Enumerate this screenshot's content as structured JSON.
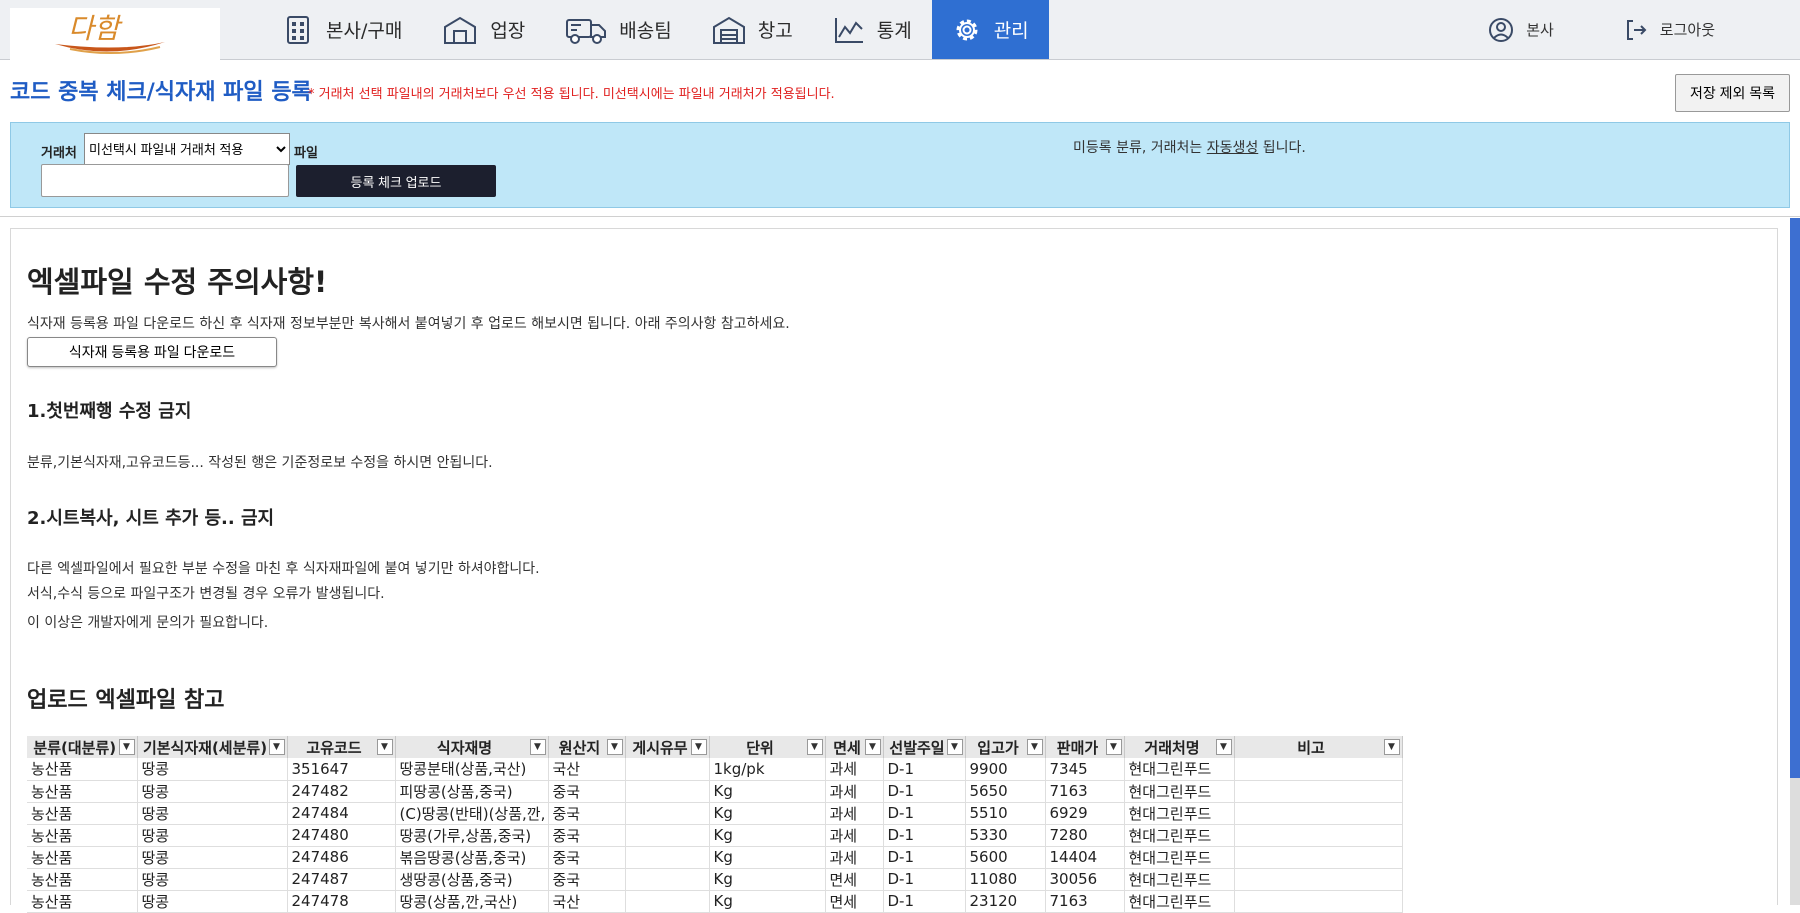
{
  "logo": {
    "text": "다함"
  },
  "nav": {
    "items": [
      {
        "label": "본사/구매",
        "icon": "building-icon"
      },
      {
        "label": "업장",
        "icon": "store-icon"
      },
      {
        "label": "배송팀",
        "icon": "truck-icon"
      },
      {
        "label": "창고",
        "icon": "warehouse-icon"
      },
      {
        "label": "통계",
        "icon": "chart-icon"
      },
      {
        "label": "관리",
        "icon": "gear-icon",
        "active": true
      }
    ],
    "user_label": "본사",
    "logout_label": "로그아웃"
  },
  "colors": {
    "accent": "#2f6fd2",
    "panel": "#bfe7f8",
    "note_red": "#e0201f",
    "title_blue": "#1f5cc4"
  },
  "header": {
    "title": "코드 중복 체크/식자재 파일 등록",
    "note": "* 거래처 선택 파일내의 거래처보다 우선 적용 됩니다. 미선택시에는 파일내 거래처가 적용됩니다.",
    "exclude_button": "저장 제외 목록"
  },
  "panel": {
    "vendor_label": "거래처",
    "vendor_selected": "미선택시 파일내 거래처 적용",
    "file_label": "파일",
    "upload_button": "등록 체크 업로드",
    "auto_note_prefix": "미등록 분류, 거래처는 ",
    "auto_note_link": "자동생성",
    "auto_note_suffix": " 됩니다."
  },
  "content": {
    "heading": "엑셀파일 수정 주의사항!",
    "intro": "식자재 등록용 파일 다운로드 하신 후 식자재 정보부분만 복사해서 붙여넣기 후 업로드 해보시면 됩니다. 아래 주의사항 참고하세요.",
    "download_button": "식자재 등록용 파일 다운로드",
    "rule1_title": "1.첫번째행 수정 금지",
    "rule1_text": "분류,기본식자재,고유코드등... 작성된 행은 기준정로보 수정을 하시면 안됩니다.",
    "rule2_title": "2.시트복사, 시트 추가 등.. 금지",
    "rule2_text1": "다른 엑셀파일에서 필요한 부분 수정을 마친 후 식자재파일에 붙여 넣기만 하셔야합니다.",
    "rule2_text2": "서식,수식 등으로 파일구조가 변경될 경우 오류가 발생됩니다.",
    "rule2_text3": "이 이상은 개발자에게 문의가 필요합니다.",
    "sample_heading": "업로드 엑셀파일 참고"
  },
  "sheet": {
    "columns": [
      "분류(대분류)",
      "기본식자재(세분류)",
      "고유코드",
      "식자재명",
      "원산지",
      "게시유무",
      "단위",
      "면세",
      "선발주일",
      "입고가",
      "판매가",
      "거래처명",
      "비고"
    ],
    "rows": [
      [
        "농산품",
        "땅콩",
        "351647",
        "땅콩분태(상품,국산)",
        "국산",
        "",
        "1kg/pk",
        "과세",
        "D-1",
        "9900",
        "7345",
        "현대그린푸드",
        ""
      ],
      [
        "농산품",
        "땅콩",
        "247482",
        "피땅콩(상품,중국)",
        "중국",
        "",
        "Kg",
        "과세",
        "D-1",
        "5650",
        "7163",
        "현대그린푸드",
        ""
      ],
      [
        "농산품",
        "땅콩",
        "247484",
        "(C)땅콩(반태)(상품,깐,",
        "중국",
        "",
        "Kg",
        "과세",
        "D-1",
        "5510",
        "6929",
        "현대그린푸드",
        ""
      ],
      [
        "농산품",
        "땅콩",
        "247480",
        "땅콩(가루,상품,중국)",
        "중국",
        "",
        "Kg",
        "과세",
        "D-1",
        "5330",
        "7280",
        "현대그린푸드",
        ""
      ],
      [
        "농산품",
        "땅콩",
        "247486",
        "볶음땅콩(상품,중국)",
        "중국",
        "",
        "Kg",
        "과세",
        "D-1",
        "5600",
        "14404",
        "현대그린푸드",
        ""
      ],
      [
        "농산품",
        "땅콩",
        "247487",
        "생땅콩(상품,중국)",
        "중국",
        "",
        "Kg",
        "면세",
        "D-1",
        "11080",
        "30056",
        "현대그린푸드",
        ""
      ],
      [
        "농산품",
        "땅콩",
        "247478",
        "땅콩(상품,깐,국산)",
        "국산",
        "",
        "Kg",
        "면세",
        "D-1",
        "23120",
        "7163",
        "현대그린푸드",
        ""
      ]
    ]
  }
}
